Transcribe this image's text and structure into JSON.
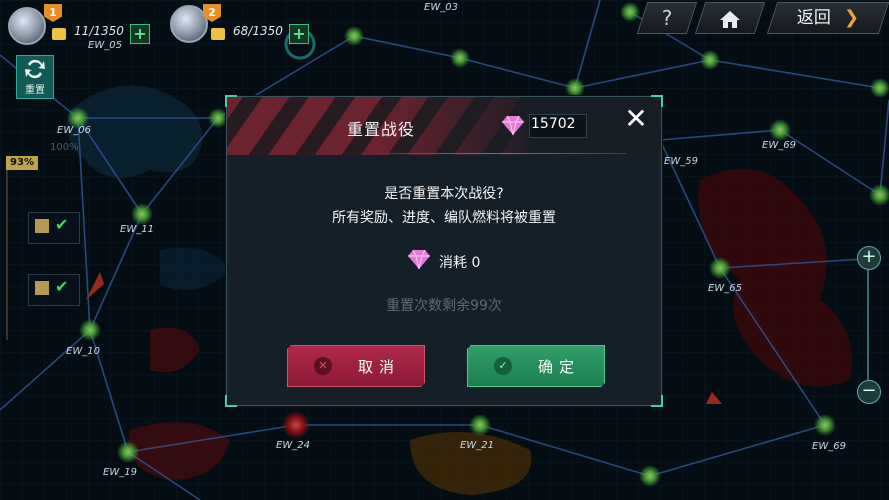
{
  "top_bar": {
    "team1": {
      "level": "1",
      "fuel": "11/1350"
    },
    "team2": {
      "level": "2",
      "fuel": "68/1350"
    },
    "help_label": "?",
    "back_label": "返回"
  },
  "side_panel": {
    "reset_label": "重置",
    "completion_percent": "93%",
    "faded_percent": "100%"
  },
  "map_nodes": [
    {
      "id": "ew-03",
      "label": "EW_03"
    },
    {
      "id": "ew-05",
      "label": "EW_05"
    },
    {
      "id": "ew-06",
      "label": "EW_06"
    },
    {
      "id": "ew-11",
      "label": "EW_11"
    },
    {
      "id": "ew-10",
      "label": "EW_10"
    },
    {
      "id": "ew-19",
      "label": "EW_19"
    },
    {
      "id": "ew-24",
      "label": "EW_24"
    },
    {
      "id": "ew-21",
      "label": "EW_21"
    },
    {
      "id": "ew-59",
      "label": "EW_59"
    },
    {
      "id": "ew-69a",
      "label": "EW_69"
    },
    {
      "id": "ew-65",
      "label": "EW_65"
    },
    {
      "id": "ew-69b",
      "label": "EW_69"
    }
  ],
  "dialog": {
    "title": "重置战役",
    "gem_balance": "15702",
    "question": "是否重置本次战役?",
    "warning": "所有奖励、进度、编队燃料将被重置",
    "cost_label": "消耗 0",
    "remaining_resets": "重置次数剩余99次",
    "cancel_label": "取消",
    "confirm_label": "确定",
    "close_symbol": "✕"
  },
  "colors": {
    "cancel": "#a32444",
    "confirm": "#26915e",
    "node_glow": "#7dff5a",
    "link_line": "#3f74c8",
    "gem": "#e57ad9"
  }
}
